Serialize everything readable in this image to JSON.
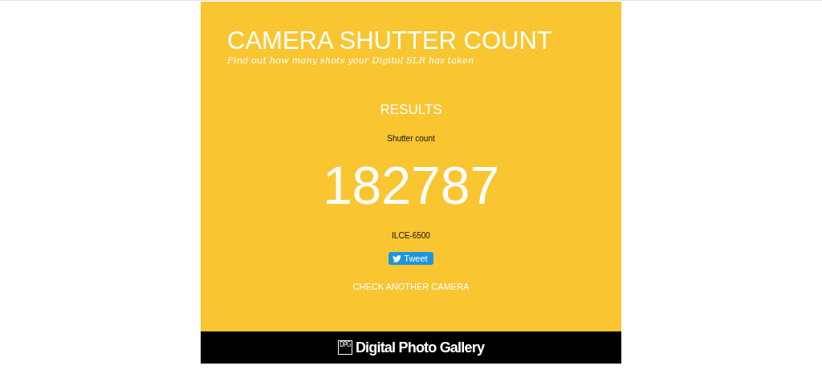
{
  "header": {
    "title": "CAMERA SHUTTER COUNT",
    "subtitle": "Find out how many shots your Digital SLR has taken"
  },
  "results": {
    "heading": "RESULTS",
    "label": "Shutter count",
    "count": "182787",
    "model": "ILCE-6500",
    "tweet_button": "Tweet",
    "check_link": "CHECK ANOTHER CAMERA"
  },
  "footer": {
    "logo_mark": "DPG",
    "brand": "Digital Photo Gallery"
  }
}
